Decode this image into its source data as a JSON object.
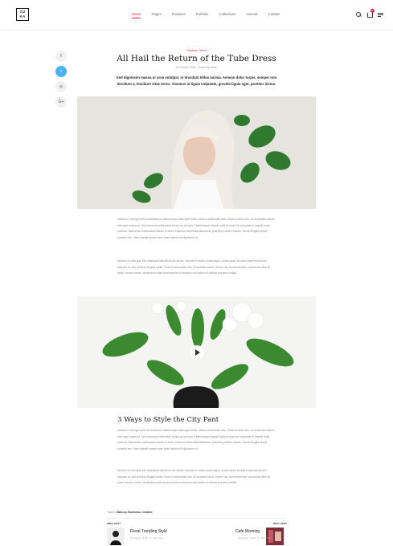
{
  "header": {
    "logo": "ZU KA",
    "nav": [
      "Home",
      "Pages",
      "Products",
      "Portfolio",
      "Collections",
      "Journal",
      "Contact"
    ],
    "cart_count": "0"
  },
  "share": {
    "facebook": "f",
    "twitter": "t",
    "instagram": "◎",
    "googleplus": "G+"
  },
  "article": {
    "category": "Fashion Trend",
    "title": "All Hail the Return of the Tube Dress",
    "meta": "16 October, 2018 - Posted by Admin",
    "lead": "Sed dignissim massa ut urna volutpat, in tincidunt tellus lacinia. Aenean dolor turpis, semper non tincidunt a, tincidunt vitae tortor. Vivamus ut ligula vulputate, gravida ligula eget, porttitor lectus.",
    "para1": "Nullam in nisi eget velit condimentum ullamcorper vitae eget tellus. Nulla a sollicitudin felis. Etiam ut felis odio. Ut venenatis mauris nibh eget euismod. Sed commodo bibendum lectus ac semper. Pellentesque blandit nulla at amet leo vulputate in blandit nulla pulvinar. Maecenas malesuada mauris ut lorem euismod venenatis.Maecenas pharetra porttitor mauris. Morbi fringilla neque sodales nec. Nam blandit laoreet ante vitae iaculis elit dignissim nt.",
    "para2": "Aenean in nibh quis elit consequat blandit at nec lectus. Aenean in metus scelerisque, luctus quam sit amet imperdiet ipsum. Aliquam ac nisl at libero feugiat mollis. Nunc id accumsan nisl. Ut sodales luctus. Donec nec leo elementum, accumsan felis sit amet, ornare metus. Vestibulum ante ipsum primis in faucibus orci luctus et ultrices posuere cubilia.",
    "subheading": "3 Ways to Style the City Pant",
    "para3": "Nullam in nisi eget velit condimentum ullamcorper vitae eget tellus. Nulla a sollicitudin felis. Etiam ut felis odio. Ut venenatis mauris nibh eget euismod. Sed commodo bibendum lectus ac semper. Pellentesque blandit nulla at amet leo vulputate in blandit nulla pulvinar. Maecenas malesuada mauris ut lorem euismod venenatis.Maecenas pharetra porttitor mauris. Morbi fringilla neque sodales nec. Nam blandit laoreet ante vitae iaculis elit dignissim nt.",
    "para4": "Aenean in nibh quis elit consequat blandit at nec lectus. Aenean in metus scelerisque, luctus quam sit amet imperdiet ipsum. Aliquam ac nisl at libero feugiat mollis. Nunc id accumsan nisl. Ut sodales luctus. Donec nec leo elementum, accumsan felis sit amet, ornare metus. Vestibulum ante ipsum primis in faucibus orci luctus et ultrices posuere cubilia.",
    "tags_label": "Topics:",
    "tags": "Start-up, Business, Creative"
  },
  "post_nav": {
    "prev_label": "PREV POST",
    "prev_title": "Floral Trending Style",
    "prev_meta": "16 August, 2018 - by John Doe",
    "next_label": "NEXT POST",
    "next_title": "Cafe Morning",
    "next_meta": "16 August, 2018 - by John Doe"
  },
  "colors": {
    "accent": "#d7263d",
    "twitter": "#4ab3f4"
  }
}
